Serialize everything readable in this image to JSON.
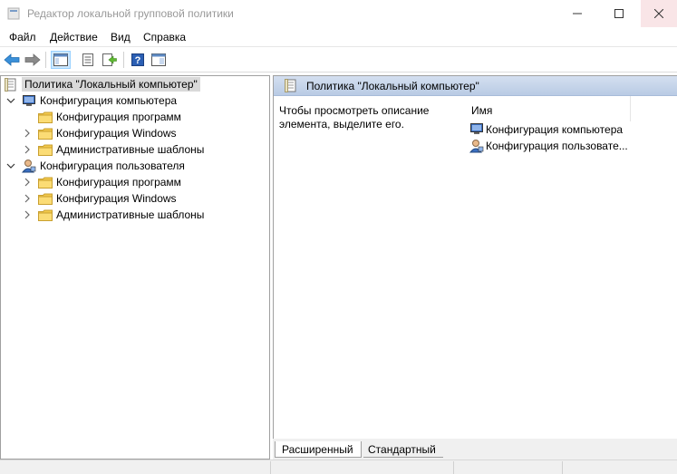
{
  "window": {
    "title": "Редактор локальной групповой политики"
  },
  "menu": {
    "items": [
      "Файл",
      "Действие",
      "Вид",
      "Справка"
    ]
  },
  "toolbar": {
    "buttons": [
      "back-icon",
      "forward-icon",
      "show-tree-icon",
      "properties-icon",
      "export-icon",
      "help-icon",
      "console-icon"
    ]
  },
  "tree": {
    "root": "Политика \"Локальный компьютер\"",
    "computer": {
      "label": "Конфигурация компьютера",
      "children": [
        "Конфигурация программ",
        "Конфигурация Windows",
        "Административные шаблоны"
      ]
    },
    "user": {
      "label": "Конфигурация пользователя",
      "children": [
        "Конфигурация программ",
        "Конфигурация Windows",
        "Административные шаблоны"
      ]
    }
  },
  "right": {
    "header": "Политика \"Локальный компьютер\"",
    "description": "Чтобы просмотреть описание элемента, выделите его.",
    "column_name": "Имя",
    "items": [
      "Конфигурация компьютера",
      "Конфигурация пользовате..."
    ]
  },
  "tabs": {
    "extended": "Расширенный",
    "standard": "Стандартный"
  },
  "colors": {
    "header_gradient_top": "#d4dff0",
    "header_gradient_bottom": "#b9cbe4",
    "close_hover": "#f9e5e7",
    "selection": "#d9d9d9",
    "folder": "#f2c94c"
  }
}
